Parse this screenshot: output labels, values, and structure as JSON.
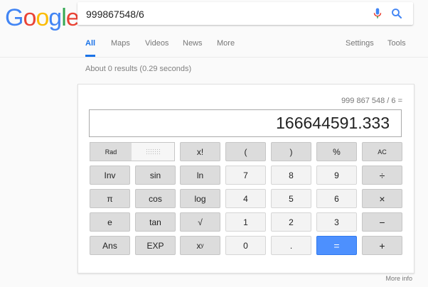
{
  "logo": {
    "letters": [
      "G",
      "o",
      "o",
      "g",
      "l",
      "e"
    ],
    "colors": [
      "#4285f4",
      "#ea4335",
      "#fbbc05",
      "#4285f4",
      "#34a853",
      "#ea4335"
    ]
  },
  "search": {
    "query": "999867548/6"
  },
  "tabs": {
    "all": "All",
    "maps": "Maps",
    "videos": "Videos",
    "news": "News",
    "more": "More",
    "settings": "Settings",
    "tools": "Tools"
  },
  "results_info": "About 0 results (0.29 seconds)",
  "calculator": {
    "expression": "999 867 548 / 6 =",
    "display": "166644591.333",
    "rad_label": "Rad",
    "keys": {
      "fact": "x!",
      "lparen": "(",
      "rparen": ")",
      "percent": "%",
      "ac": "AC",
      "inv": "Inv",
      "sin": "sin",
      "ln": "ln",
      "seven": "7",
      "eight": "8",
      "nine": "9",
      "divide": "÷",
      "pi": "π",
      "cos": "cos",
      "log": "log",
      "four": "4",
      "five": "5",
      "six": "6",
      "multiply": "×",
      "e": "e",
      "tan": "tan",
      "sqrt": "√",
      "one": "1",
      "two": "2",
      "three": "3",
      "minus": "−",
      "ans": "Ans",
      "exp": "EXP",
      "pow_base": "x",
      "pow_exp": "y",
      "zero": "0",
      "dot": ".",
      "equals": "=",
      "plus": "+"
    }
  },
  "more_info": "More info",
  "colors": {
    "accent": "#1a73e8",
    "equals_button": "#4d90fe"
  }
}
